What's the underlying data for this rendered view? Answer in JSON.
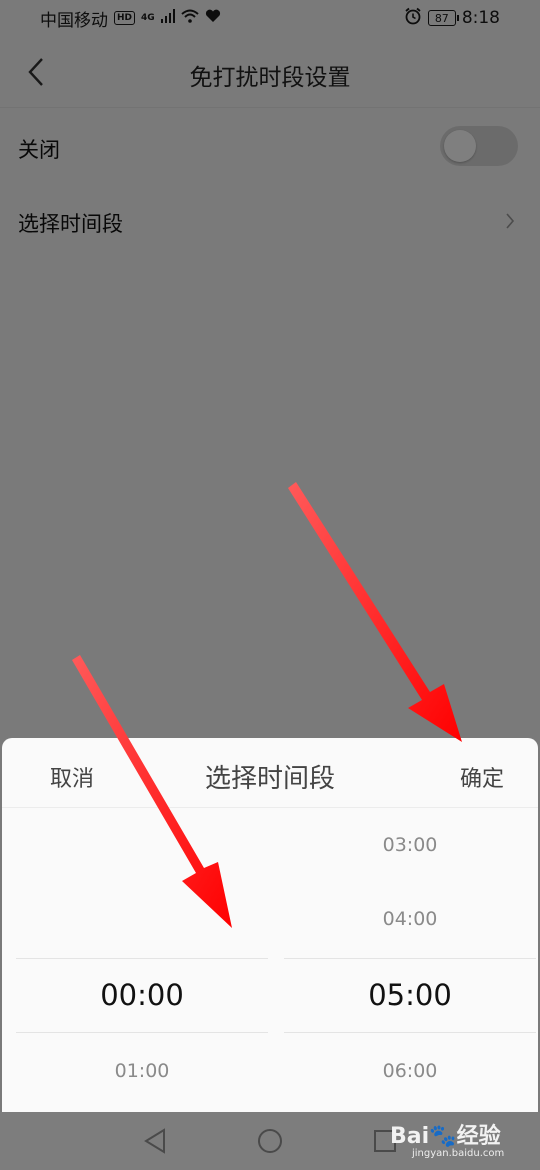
{
  "status_bar": {
    "carrier": "中国移动",
    "hd_tag": "HD",
    "network": "4G",
    "battery": "87",
    "time": "8:18"
  },
  "header": {
    "title": "免打扰时段设置"
  },
  "settings": {
    "toggle_label": "关闭",
    "toggle_on": false,
    "time_range_label": "选择时间段"
  },
  "sheet": {
    "cancel_label": "取消",
    "title": "选择时间段",
    "confirm_label": "确定",
    "start_times": [
      "",
      "",
      "00:00",
      "01:00"
    ],
    "end_times": [
      "03:00",
      "04:00",
      "05:00",
      "06:00"
    ],
    "start_selected": "00:00",
    "end_selected": "05:00"
  },
  "watermark": {
    "brand": "Bai",
    "brand_cn": "经验",
    "url": "jingyan.baidu.com"
  },
  "colors": {
    "annotation_arrow": "#ff1a1a",
    "overlay": "#808080",
    "toggle_off": "#d7d7d7"
  }
}
